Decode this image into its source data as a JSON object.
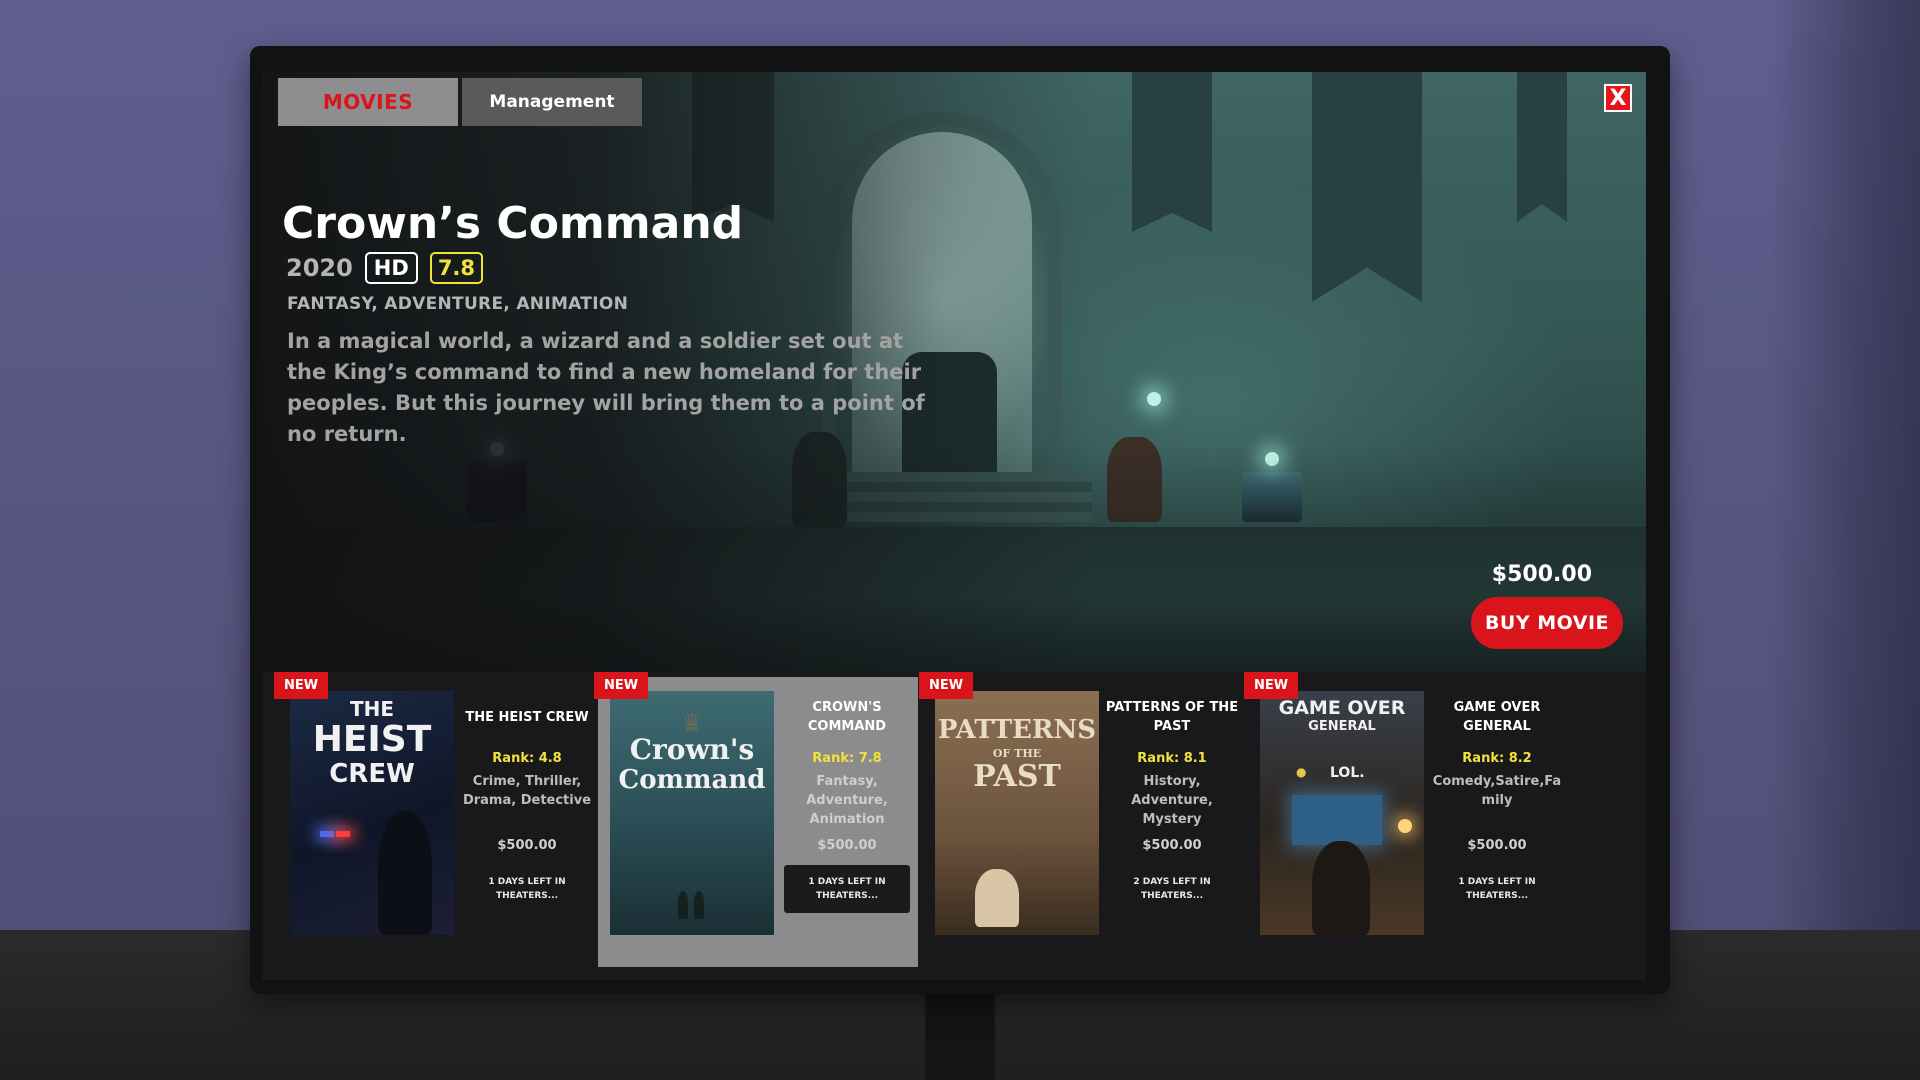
{
  "tabs": {
    "movies": "MOVIES",
    "management": "Management"
  },
  "close_label": "X",
  "featured": {
    "title": "Crown’s Command",
    "year": "2020",
    "quality": "HD",
    "rating": "7.8",
    "genres": "FANTASY, ADVENTURE, ANIMATION",
    "description": "In a magical world, a wizard and a soldier set out at the King’s command to find a new homeland for their peoples. But this journey will bring them to a point of no return.",
    "price": "$500.00",
    "buy_label": "BUY MOVIE"
  },
  "movies": [
    {
      "badge": "NEW",
      "poster_text": [
        "THE",
        "HEIST",
        "CREW"
      ],
      "title": "THE HEIST CREW",
      "rank": "Rank: 4.8",
      "genres": "Crime, Thriller, Drama, Detective",
      "price": "$500.00",
      "days": "1 DAYS LEFT IN THEATERS..."
    },
    {
      "badge": "NEW",
      "poster_text": [
        "Crown's",
        "Command"
      ],
      "title": "CROWN'S COMMAND",
      "rank": "Rank: 7.8",
      "genres": "Fantasy, Adventure, Animation",
      "price": "$500.00",
      "days": "1 DAYS LEFT IN THEATERS...",
      "selected": true
    },
    {
      "badge": "NEW",
      "poster_text": [
        "PATTERNS",
        "OF THE",
        "PAST"
      ],
      "title": "PATTERNS OF THE PAST",
      "rank": "Rank: 8.1",
      "genres": "History, Adventure, Mystery",
      "price": "$500.00",
      "days": "2 DAYS LEFT IN THEATERS..."
    },
    {
      "badge": "NEW",
      "poster_text": [
        "GAME OVER",
        "GENERAL",
        "LOL."
      ],
      "title": "GAME OVER GENERAL",
      "rank": "Rank: 8.2",
      "genres": "Comedy,Satire,Fa mily",
      "price": "$500.00",
      "days": "1 DAYS LEFT IN THEATERS..."
    }
  ],
  "colors": {
    "accent_red": "#d9151b",
    "rank_yellow": "#f2e23b",
    "selected_card": "#8c8c8f"
  }
}
